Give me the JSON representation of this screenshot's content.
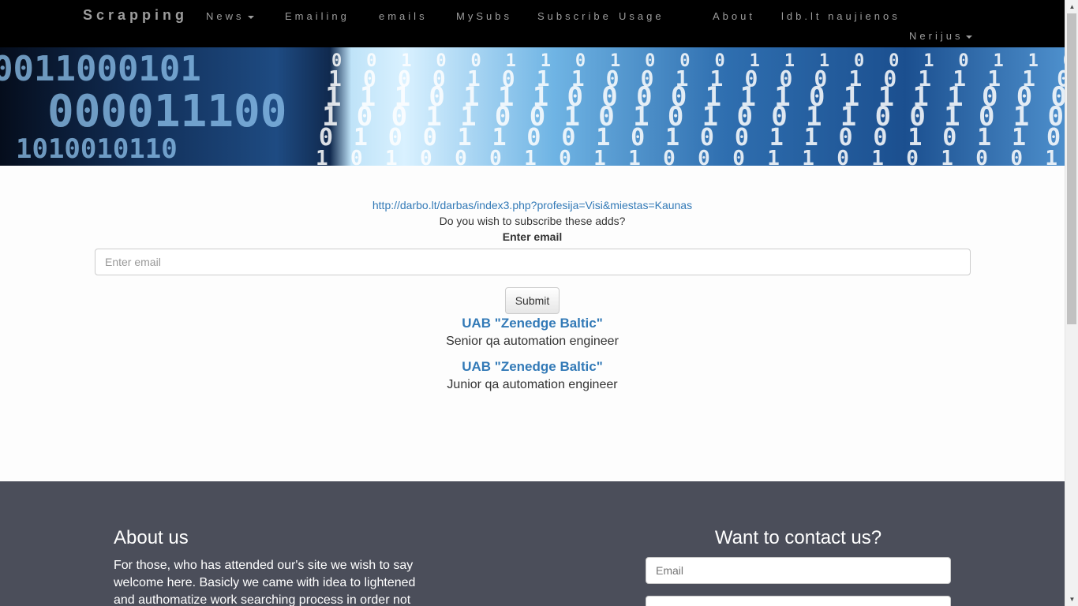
{
  "navbar": {
    "brand": "Scrapping",
    "items": [
      {
        "label": "News"
      },
      {
        "label": "Emailing"
      },
      {
        "label": "emails"
      },
      {
        "label": "MySubs"
      },
      {
        "label": "Subscribe"
      },
      {
        "label": "Usage"
      },
      {
        "label": "About"
      },
      {
        "label": "ldb.lt naujienos"
      }
    ],
    "user": "Nerijus"
  },
  "main": {
    "url": "http://darbo.lt/darbas/index3.php?profesija=Visi&miestas=Kaunas",
    "question": "Do you wish to subscribe these adds?",
    "email_label": "Enter email",
    "email_placeholder": "Enter email",
    "submit_label": "Submit",
    "results": [
      {
        "company": "UAB \"Zenedge Baltic\"",
        "position": "Senior qa automation engineer"
      },
      {
        "company": "UAB \"Zenedge Baltic\"",
        "position": "Junior qa automation engineer"
      }
    ]
  },
  "footer": {
    "about_title": "About us",
    "about_text": "For those, who has attended our's site we wish to say welcome here. Basicly we came with idea to lightened and authomatize work searching process in order not to",
    "contact_title": "Want to contact us?",
    "email_placeholder": "Email"
  },
  "banner": {
    "rows": [
      "0010011010001110010110",
      "1000101100110001011110",
      "1110111000011101111000",
      "1001100101010011001010",
      "0100110010100110010110",
      "1010001011000110101001"
    ]
  }
}
